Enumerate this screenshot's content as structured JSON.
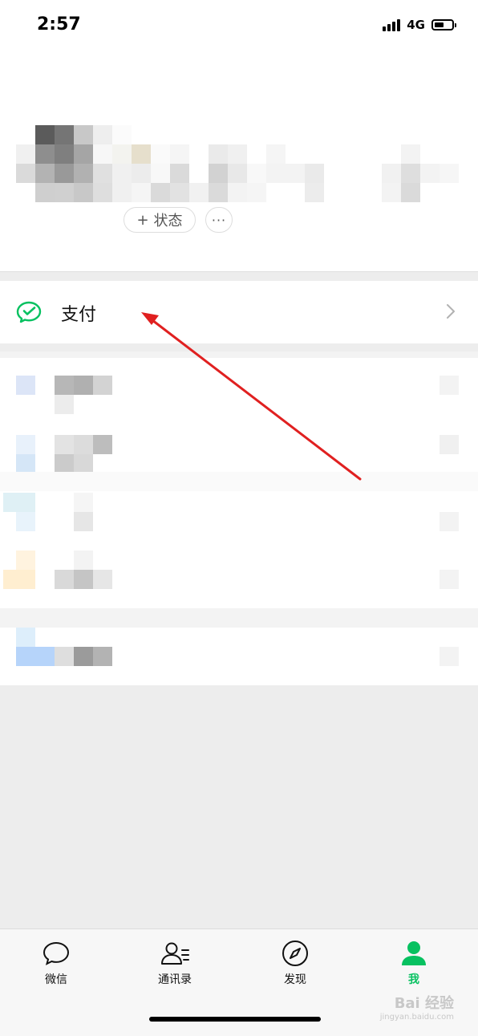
{
  "status_bar": {
    "time": "2:57",
    "network": "4G",
    "battery_level": 0.55
  },
  "profile": {
    "status_button_plus": "+",
    "status_button_label": "状态",
    "more_button_label": "···"
  },
  "menu": {
    "pay": {
      "label": "支付",
      "icon": "wechat-pay-icon",
      "accent": "#07c160"
    }
  },
  "tab_bar": {
    "tabs": [
      {
        "label": "微信",
        "icon": "chat-bubble-icon",
        "active": false
      },
      {
        "label": "通讯录",
        "icon": "contacts-icon",
        "active": false
      },
      {
        "label": "发现",
        "icon": "compass-icon",
        "active": false
      },
      {
        "label": "我",
        "icon": "person-icon",
        "active": true
      }
    ],
    "active_color": "#07c160"
  },
  "annotation": {
    "arrow_color": "#e02020"
  },
  "watermark": {
    "text": "Bai 经验",
    "sub": "jingyan.baidu.com"
  }
}
